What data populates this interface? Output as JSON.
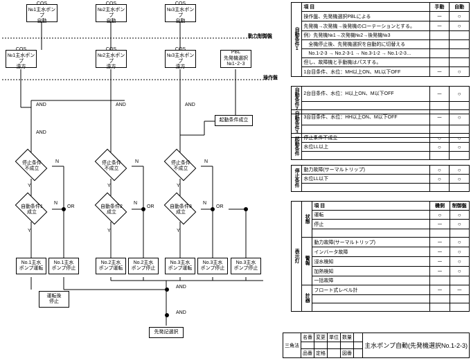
{
  "flowchart": {
    "cos": "COS",
    "pump1": "№1主水ポンプ",
    "pump2": "№2主水ポンプ",
    "pump3": "№3主水ポンプ",
    "auto": "自動",
    "remote": "遠方",
    "pbl": "PBL",
    "leadSelect": "先発機選択",
    "leadOrder": "№1･2･3",
    "startCond": "起動条件成立",
    "stopCond": "停止条件\n不成立",
    "autoCond1": "自動条件1\n成立",
    "autoCond2": "自動条件2\n成立",
    "autoCond3": "自動条件3\n成立",
    "p1Run": "No.1主水\nポンプ運転",
    "p1Stop": "No.1主水\nポンプ停止",
    "p2Run": "No.2主水\nポンプ運転",
    "p2Stop": "No.2主水\nポンプ停止",
    "p3Run": "No.3主水\nポンプ運転",
    "p3Stop": "No.3主水\nポンプ停止",
    "afterRunStop": "運転後\n停止",
    "leadOrderSelect": "先発記選択",
    "and": "AND",
    "or": "OR",
    "y": "Y",
    "n": "N",
    "panelPower": "動力制御盤",
    "panelOp": "操作盤"
  },
  "table1": {
    "header": {
      "item": "項 目",
      "manual": "手動",
      "auto": "自動"
    },
    "rows": [
      {
        "item": "操作盤、先発機選択PBLによる",
        "m": "－",
        "a": "○"
      },
      {
        "item": "先発機→次発機→後発機のローテーションとする。",
        "m": "－",
        "a": "○"
      },
      {
        "item": "例）先発機№1→次発機№2→後発機№3",
        "m": "",
        "a": ""
      },
      {
        "item": "　全機停止後、先発機選択を自動的に切替える",
        "m": "",
        "a": ""
      },
      {
        "item": "　No.1-2-3 → No.2-3-1 → No.3-1-2 → No.1-2-3…",
        "m": "",
        "a": ""
      },
      {
        "item": "但し、故障機と手動機はパスする。",
        "m": "",
        "a": ""
      },
      {
        "item": "1台目条件、水位：MH以上ON、ML以下OFF",
        "m": "－",
        "a": "○"
      }
    ],
    "group": "自動条件1"
  },
  "table1b": {
    "rows": [
      {
        "item": "2台目条件、水位：H以上ON、M以下OFF",
        "m": "－",
        "a": "○"
      }
    ],
    "group": "自動条件2"
  },
  "table1c": {
    "rows": [
      {
        "item": "3台目条件、水位：HH以上ON、M以下OFF",
        "m": "－",
        "a": "○"
      }
    ],
    "group": "自動条件3"
  },
  "table2": {
    "rows": [
      {
        "item": "停止条件不成立",
        "m": "○",
        "a": "○"
      },
      {
        "item": "水位LL以上",
        "m": "○",
        "a": "○"
      }
    ],
    "group": "起動条件"
  },
  "table3": {
    "rows": [
      {
        "item": "動力故障(サーマルトリップ)",
        "m": "○",
        "a": "○"
      },
      {
        "item": "水位LL以下",
        "m": "○",
        "a": "○"
      }
    ],
    "group": "停止条件"
  },
  "table4": {
    "header": {
      "item": "項 目",
      "local": "機側",
      "panel": "制御盤"
    },
    "group1": "状態",
    "rows1": [
      {
        "item": "運転",
        "m": "○",
        "a": "○"
      },
      {
        "item": "停止",
        "m": "－",
        "a": "○"
      },
      {
        "item": "",
        "m": "",
        "a": ""
      }
    ],
    "group2": "警報",
    "rows2": [
      {
        "item": "動力故障(サーマルトリップ)",
        "m": "－",
        "a": "○"
      },
      {
        "item": "インバータ故障",
        "m": "－",
        "a": "○"
      },
      {
        "item": "浸水検知",
        "m": "－",
        "a": "○"
      },
      {
        "item": "加熱検知",
        "m": "－",
        "a": "○"
      },
      {
        "item": "一括故障",
        "m": "",
        "a": ""
      }
    ],
    "sideLabel": "表示灯",
    "meterRow": {
      "item": "フロート式レベル計",
      "m": "－",
      "a": "－"
    },
    "meterGroup": "計器"
  },
  "titleBlock": {
    "main": "主水ポンプ自動(先発機選択No.1-2-3)",
    "triangle": "三角法",
    "cells": [
      "名番",
      "変更",
      "単位",
      "数量",
      "",
      "",
      "品番",
      "定格",
      "図番"
    ]
  }
}
